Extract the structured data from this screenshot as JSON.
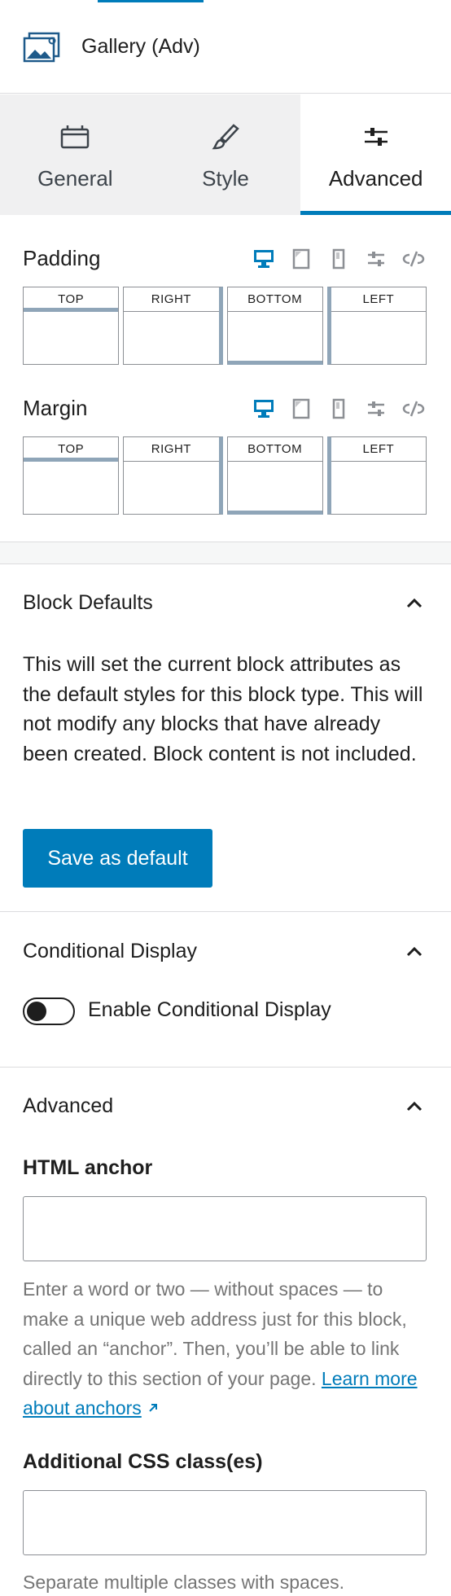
{
  "block": {
    "title": "Gallery (Adv)",
    "icon": "gallery-image-icon"
  },
  "tabs": [
    {
      "label": "General",
      "icon": "general-panel-icon",
      "active": false
    },
    {
      "label": "Style",
      "icon": "brush-icon",
      "active": false
    },
    {
      "label": "Advanced",
      "icon": "sliders-icon",
      "active": true
    }
  ],
  "padding": {
    "label": "Padding",
    "boxes": [
      "TOP",
      "RIGHT",
      "BOTTOM",
      "LEFT"
    ]
  },
  "margin": {
    "label": "Margin",
    "boxes": [
      "TOP",
      "RIGHT",
      "BOTTOM",
      "LEFT"
    ]
  },
  "device_icons": [
    "desktop-icon",
    "tablet-icon",
    "mobile-icon",
    "settings-sliders-icon",
    "unlink-icon"
  ],
  "block_defaults": {
    "title": "Block Defaults",
    "description": "This will set the current block attributes as the default styles for this block type. This will not modify any blocks that have already been created. Block content is not included.",
    "button_label": "Save as default"
  },
  "conditional_display": {
    "title": "Conditional Display",
    "toggle_label": "Enable Conditional Display",
    "enabled": false
  },
  "advanced": {
    "title": "Advanced",
    "html_anchor_label": "HTML anchor",
    "html_anchor_value": "",
    "help_text": "Enter a word or two — without spaces — to make a unique web address just for this block, called an “anchor”. Then, you’ll be able to link directly to this section of your page.",
    "help_link": "Learn more about anchors",
    "css_class_label": "Additional CSS class(es)",
    "css_class_value": "",
    "css_help": "Separate multiple classes with spaces."
  },
  "colors": {
    "accent": "#007cba",
    "panel_bg": "#f0f0f1",
    "border": "#8c8f94",
    "side_highlight": "#8fa5b8"
  }
}
